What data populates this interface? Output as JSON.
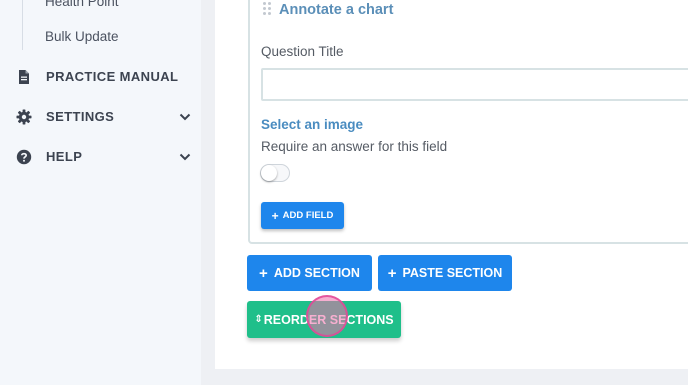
{
  "sidebar": {
    "sub_items": [
      "Health Point",
      "Bulk Update"
    ],
    "items": [
      {
        "label": "PRACTICE MANUAL",
        "icon": "document-icon",
        "has_chevron": false
      },
      {
        "label": "SETTINGS",
        "icon": "gear-icon",
        "has_chevron": true
      },
      {
        "label": "HELP",
        "icon": "question-circle-icon",
        "has_chevron": true
      }
    ]
  },
  "field": {
    "type_label": "Annotate a chart",
    "question_title_label": "Question Title",
    "question_title_value": "",
    "select_image_label": "Select an image",
    "require_label": "Require an answer for this field",
    "require_enabled": false,
    "add_field_label": "ADD FIELD"
  },
  "actions": {
    "add_section_label": "ADD SECTION",
    "paste_section_label": "PASTE SECTION",
    "reorder_sections_label": "REORDER SECTIONS"
  },
  "colors": {
    "primary_button": "#1e86ec",
    "reorder_button": "#1fbf8a",
    "field_title": "#5b8fb8",
    "sidebar_bg": "#f4f7fb"
  }
}
